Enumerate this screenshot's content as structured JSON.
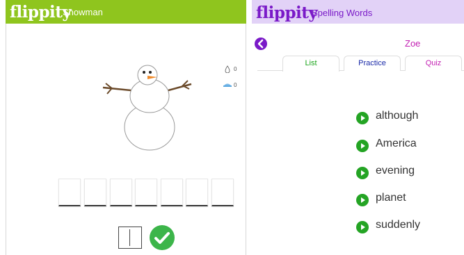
{
  "left_app": {
    "brand": "flippity",
    "title": "Snowman",
    "counters": {
      "wrong_count": "0",
      "hint_count": "0"
    },
    "word_length": 7,
    "icons": {
      "counter1": "drop-icon",
      "counter2": "hat-icon",
      "submit": "check-icon"
    },
    "colors": {
      "topbar": "#8fc51e",
      "submit": "#3cb54a"
    }
  },
  "right_app": {
    "brand": "flippity",
    "title": "Spelling Words",
    "user": "Zoe",
    "back_icon": "back-arrow-icon",
    "tabs": [
      {
        "label": "List",
        "color": "#1aa41a"
      },
      {
        "label": "Practice",
        "color": "#1a2aa8"
      },
      {
        "label": "Quiz",
        "color": "#c21fb2"
      }
    ],
    "words": [
      "although",
      "America",
      "evening",
      "planet",
      "suddenly"
    ],
    "play_icon": "play-icon",
    "colors": {
      "topbar": "#e2d2f7",
      "accent": "#7a1ac8",
      "play": "#24a424"
    }
  }
}
